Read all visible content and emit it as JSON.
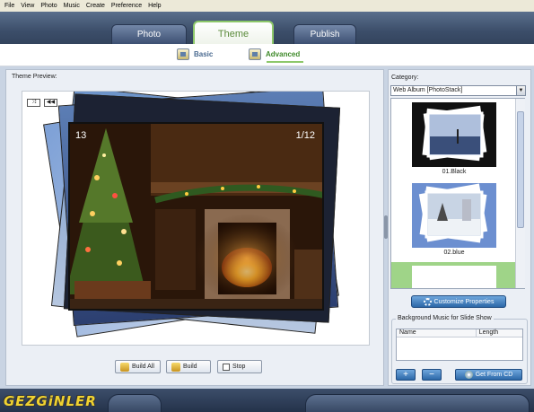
{
  "menu": [
    "File",
    "View",
    "Photo",
    "Music",
    "Create",
    "Preference",
    "Help"
  ],
  "tabs": [
    {
      "label": "Photo",
      "active": false
    },
    {
      "label": "Theme",
      "active": true
    },
    {
      "label": "Publish",
      "active": false
    }
  ],
  "subtabs": [
    {
      "label": "Basic",
      "active": false
    },
    {
      "label": "Advanced",
      "active": true
    }
  ],
  "preview": {
    "label": "Theme Preview:",
    "counter_left": "13",
    "counter_right": "1/12",
    "controls": [
      "⤨",
      "◀◀"
    ]
  },
  "actions": {
    "build_all": "Build All",
    "build": "Build",
    "stop": "Stop"
  },
  "category": {
    "label": "Category:",
    "selected": "Web Album [PhotoStack]",
    "thumbnails": [
      {
        "caption": "01.Black",
        "selected": false
      },
      {
        "caption": "02.blue",
        "selected": false
      },
      {
        "caption": "",
        "selected": true
      }
    ],
    "customize_label": "Customize Properties"
  },
  "music": {
    "group_title": "Background Music for Slide Show",
    "columns": [
      "Name",
      "Length"
    ],
    "add_label": "+",
    "remove_label": "−",
    "cd_label": "Get From CD"
  },
  "watermark": "GEZGiNLER",
  "colors": {
    "accent_green": "#8dc86a",
    "nav_blue": "#3c4e6a",
    "button_blue": "#2c68a8"
  }
}
